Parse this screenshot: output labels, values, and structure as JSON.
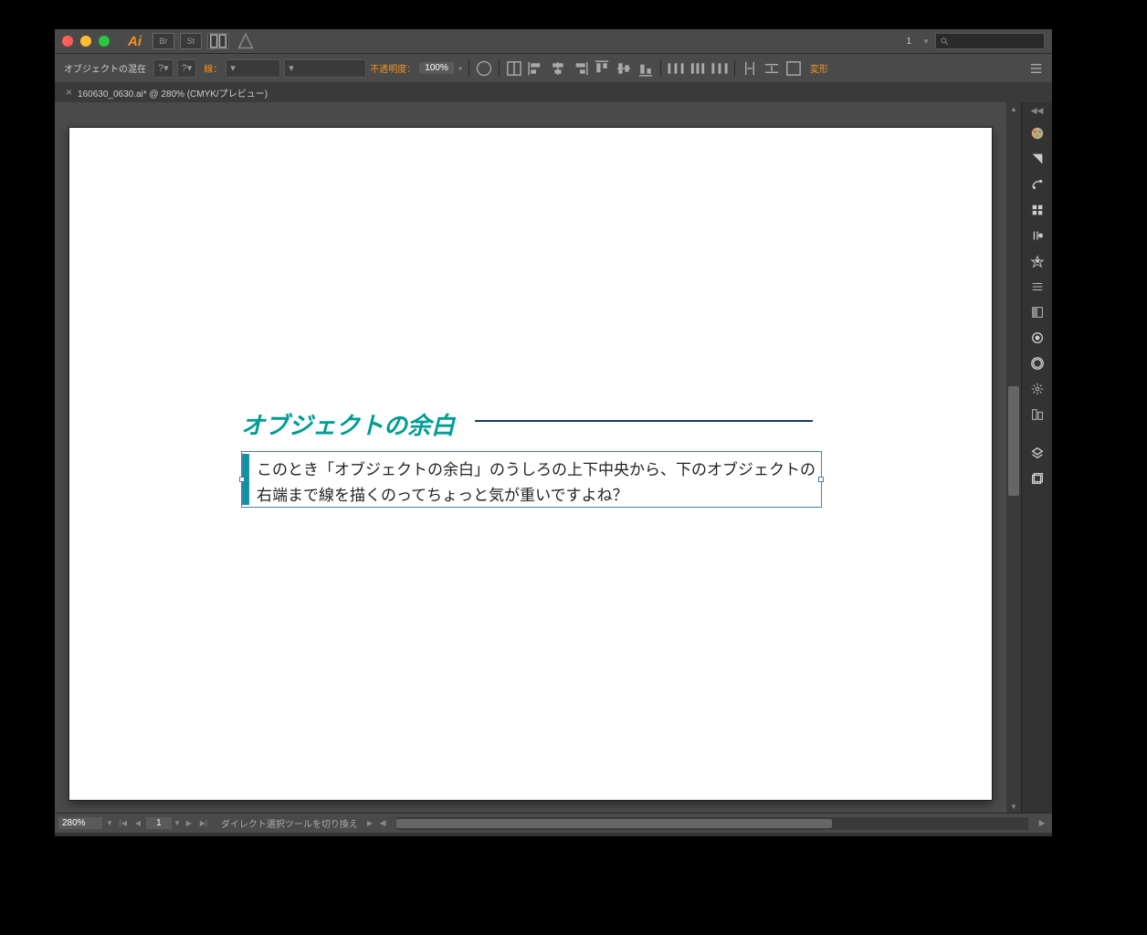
{
  "titlebar": {
    "app_logo": "Ai",
    "workspace": "1"
  },
  "control_bar": {
    "selection_label": "オブジェクトの混在",
    "stroke_label": "線：",
    "opacity_label": "不透明度：",
    "opacity_value": "100%",
    "transform_label": "変形"
  },
  "doc_tab": {
    "name": "160630_0630.ai* @ 280% (CMYK/プレビュー)"
  },
  "artboard": {
    "heading": "オブジェクトの余白",
    "body_line1": "このとき「オブジェクトの余白」のうしろの上下中央から、下のオブジェクトの",
    "body_line2": "右端まで線を描くのってちょっと気が重いですよね？"
  },
  "status_bar": {
    "zoom": "280%",
    "artboard_num": "1",
    "tool_hint": "ダイレクト選択ツールを切り換え"
  },
  "panels": [
    "color",
    "swatches",
    "brushes",
    "symbols",
    "stroke",
    "gradient",
    "transparency",
    "appearance",
    "graphic-styles",
    "layers",
    "artboards"
  ]
}
